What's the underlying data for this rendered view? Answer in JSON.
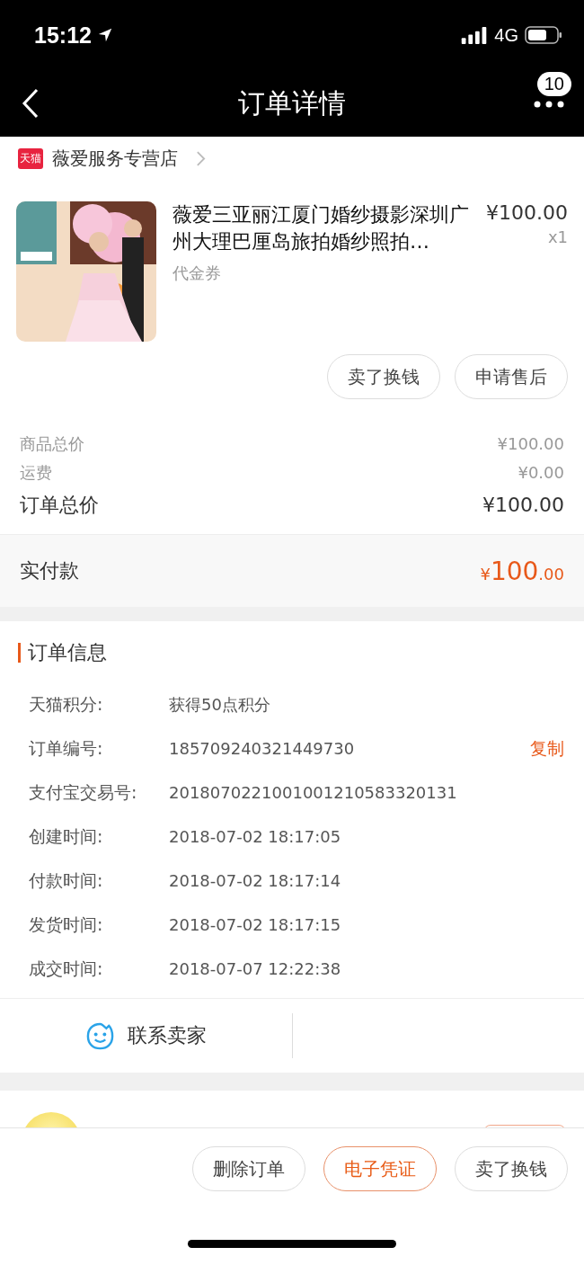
{
  "status_bar": {
    "time": "15:12",
    "network": "4G"
  },
  "nav": {
    "title": "订单详情",
    "badge": "10"
  },
  "store": {
    "badge": "天猫",
    "name": "薇爱服务专营店"
  },
  "product": {
    "kind": "picture",
    "title": "薇爱三亚丽江厦门婚纱摄影深圳广州大理巴厘岛旅拍婚纱照拍…",
    "price": "¥100.00",
    "quantity": "x1",
    "tag": "代金券"
  },
  "item_actions": [
    {
      "label": "卖了换钱",
      "primary": false
    },
    {
      "label": "申请售后",
      "primary": false
    }
  ],
  "summary": [
    {
      "label": "商品总价",
      "value": "¥100.00",
      "emphasis": false
    },
    {
      "label": "运费",
      "value": "¥0.00",
      "emphasis": false
    },
    {
      "label": "订单总价",
      "value": "¥100.00",
      "emphasis": true
    }
  ],
  "paid": {
    "label": "实付款",
    "currency": "¥",
    "integer": "100",
    "decimals": ".00"
  },
  "order_info": {
    "title": "订单信息",
    "rows": [
      {
        "label": "天猫积分:",
        "value": "获得50点积分"
      },
      {
        "label": "订单编号:",
        "value": "185709240321449730",
        "action": "复制"
      },
      {
        "label": "支付宝交易号:",
        "value": "2018070221001001210583320131"
      },
      {
        "label": "创建时间:",
        "value": "2018-07-02 18:17:05"
      },
      {
        "label": "付款时间:",
        "value": "2018-07-02 18:17:14"
      },
      {
        "label": "发货时间:",
        "value": "2018-07-02 18:17:15"
      },
      {
        "label": "成交时间:",
        "value": "2018-07-07 12:22:38"
      }
    ]
  },
  "contact": {
    "label": "联系卖家"
  },
  "bottom_actions": [
    {
      "label": "删除订单",
      "primary": false
    },
    {
      "label": "电子凭证",
      "primary": true
    },
    {
      "label": "卖了换钱",
      "primary": false
    }
  ]
}
